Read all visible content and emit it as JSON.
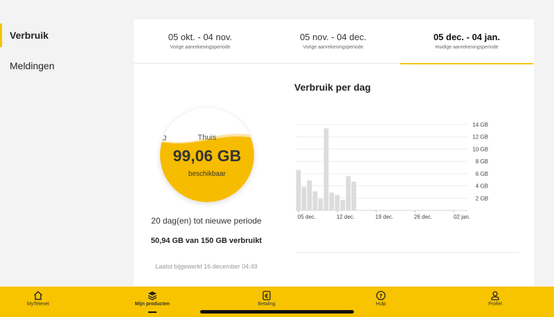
{
  "sidebar": {
    "items": [
      {
        "label": "Verbruik",
        "active": true
      },
      {
        "label": "Meldingen",
        "active": false
      }
    ]
  },
  "tabs": [
    {
      "period": "05 okt. - 04 nov.",
      "caption": "Vorige aanrekeningsperiode",
      "active": false
    },
    {
      "period": "05 nov. - 04 dec.",
      "caption": "Vorige aanrekeningsperiode",
      "active": false
    },
    {
      "period": "05 dec. - 04 jan.",
      "caption": "Huidige aanrekeningsperiode",
      "active": true
    }
  ],
  "usage": {
    "location": "Thuis",
    "available": "99,06 GB",
    "available_label": "beschikbaar",
    "remaining_fraction": 0.66,
    "days_left": "20 dag(en) tot nieuwe periode",
    "used_summary": "50,94 GB van 150 GB verbruikt",
    "last_updated": "Laatst bijgewerkt 16 december 04:49"
  },
  "chart_title": "Verbruik per dag",
  "chart_data": {
    "type": "bar",
    "title": "Verbruik per dag",
    "x_tick_labels": [
      "05 dec.",
      "12 dec.",
      "19 dec.",
      "26 dec.",
      "02 jan."
    ],
    "y_tick_labels": [
      "2 GB",
      "4 GB",
      "6 GB",
      "8 GB",
      "10 GB",
      "12 GB",
      "14 GB"
    ],
    "ylim": [
      0,
      14
    ],
    "y_axis_position": "right",
    "grid": true,
    "categories": [
      "05 dec.",
      "06 dec.",
      "07 dec.",
      "08 dec.",
      "09 dec.",
      "10 dec.",
      "11 dec.",
      "12 dec.",
      "13 dec.",
      "14 dec.",
      "15 dec."
    ],
    "values": [
      6.6,
      3.8,
      4.9,
      3.1,
      1.9,
      13.4,
      2.9,
      2.5,
      1.7,
      5.6,
      4.7
    ],
    "bar_color": "#dcdcdc"
  },
  "bottom_nav": [
    {
      "label": "MyTelenet",
      "icon": "home-icon",
      "active": false
    },
    {
      "label": "Mijn producten",
      "icon": "layers-icon",
      "active": true
    },
    {
      "label": "Betaling",
      "icon": "euro-icon",
      "active": false
    },
    {
      "label": "Hulp",
      "icon": "help-icon",
      "active": false
    },
    {
      "label": "Profiel",
      "icon": "profile-icon",
      "active": false
    }
  ],
  "colors": {
    "accent": "#f8c400",
    "gauge_fill": "#f8c400",
    "gauge_fill_dark": "#f3b000"
  }
}
